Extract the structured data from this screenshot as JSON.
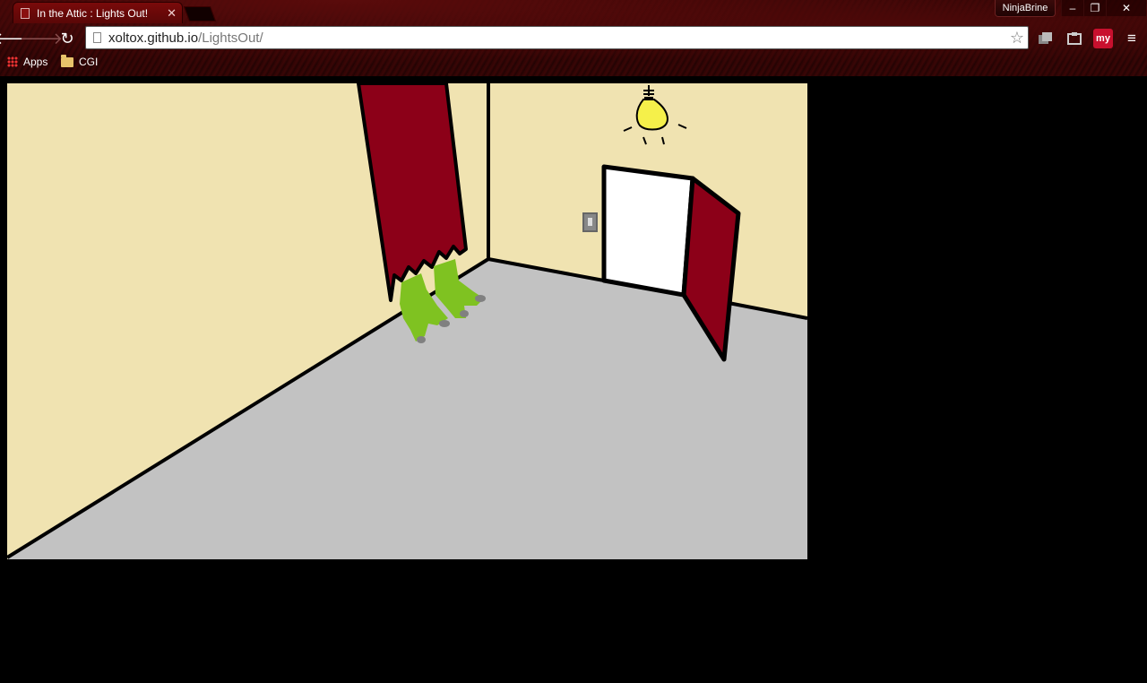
{
  "window": {
    "user_name": "NinjaBrine",
    "minimize": "–",
    "restore": "❐",
    "close": "✕"
  },
  "tab": {
    "title": "In the Attic : Lights Out!",
    "close": "✕"
  },
  "toolbar": {
    "back": "🡐",
    "forward": "🡒",
    "reload": "↻",
    "url_host": "xoltox.github.io",
    "url_path": "/LightsOut/",
    "star": "☆",
    "ext_my_label": "my",
    "menu": "≡"
  },
  "bookmarks": {
    "apps_label": "Apps",
    "folder_label": "CGI"
  },
  "colors": {
    "wall": "#f0e3b1",
    "floor": "#c2c2c2",
    "curtain": "#8c0018",
    "creature": "#7fc221",
    "bulb": "#f5f04a",
    "outline": "#000000"
  }
}
